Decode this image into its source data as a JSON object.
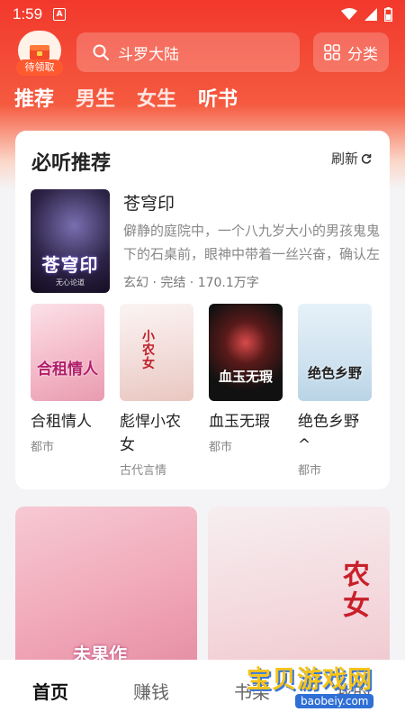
{
  "status": {
    "time": "1:59",
    "a_icon": "A"
  },
  "gift": {
    "badge": "待领取",
    "icon": "gift-box-icon"
  },
  "search": {
    "placeholder": "斗罗大陆"
  },
  "category": {
    "label": "分类"
  },
  "tabs": [
    "推荐",
    "男生",
    "女生",
    "听书"
  ],
  "card": {
    "title": "必听推荐",
    "refresh": "刷新",
    "featured": {
      "title": "苍穹印",
      "cover_title": "苍穹印",
      "cover_author": "无心论道",
      "desc_line1": "僻静的庭院中，一个八九岁大小的男孩鬼鬼",
      "desc_line2": "下的石桌前，眼神中带着一丝兴奋，确认左",
      "meta": "玄幻 · 完结 · 170.1万字"
    },
    "books": [
      {
        "name": "合租情人",
        "tag": "都市",
        "cover_text": "合租情人"
      },
      {
        "name": "彪悍小农女",
        "tag": "古代言情",
        "cover_text": "小农女"
      },
      {
        "name": "血玉无瑕",
        "tag": "都市",
        "cover_text": "血玉无瑕"
      },
      {
        "name": "绝色乡野^",
        "tag": "都市",
        "cover_text": "绝色乡野"
      }
    ]
  },
  "big_covers": {
    "left_text": "未果作",
    "right_text": "农女"
  },
  "nav": {
    "home": "首页",
    "earn": "赚钱",
    "shelf": "书架",
    "mine": "我的"
  },
  "watermark": {
    "text": "宝贝游戏网",
    "url": "baobeiy.com"
  },
  "colors": {
    "brand": "#f2382c",
    "accent": "#ff5a2f"
  }
}
